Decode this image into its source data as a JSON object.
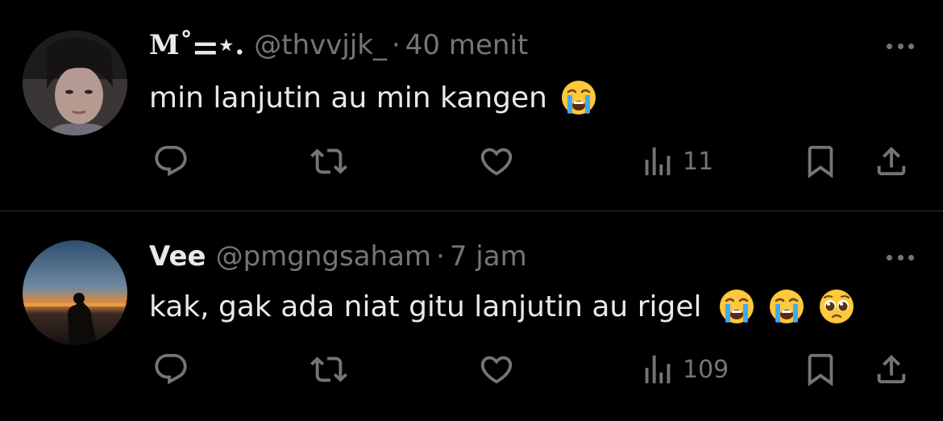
{
  "tweets": [
    {
      "display_name": "M˚⚌⋆.",
      "handle": "@thvvjjk_",
      "separator": "·",
      "time": "40 menit",
      "text": "min lanjutin au min kangen",
      "emojis": [
        "loudly-crying-face"
      ],
      "views": "11"
    },
    {
      "display_name": "Vee",
      "handle": "@pmgngsaham",
      "separator": "·",
      "time": "7 jam",
      "text": "kak, gak ada niat gitu lanjutin au rigel",
      "emojis": [
        "loudly-crying-face",
        "loudly-crying-face",
        "pleading-face"
      ],
      "views": "109"
    }
  ],
  "icons": {
    "reply": "reply-icon",
    "retweet": "retweet-icon",
    "like": "heart-icon",
    "views": "views-icon",
    "bookmark": "bookmark-icon",
    "share": "share-icon",
    "more": "more-icon"
  },
  "colors": {
    "background": "#000000",
    "primary_text": "#e7e9ea",
    "secondary_text": "#71767b",
    "divider": "#2f3336"
  }
}
